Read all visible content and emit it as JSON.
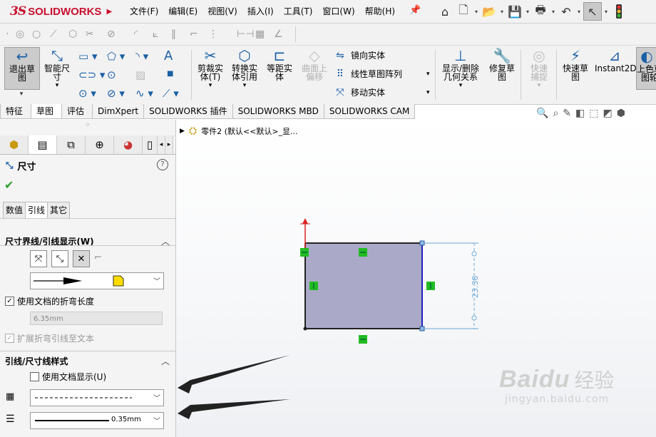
{
  "app": {
    "logo_prefix": "3S",
    "logo_text": "SOLIDWORKS"
  },
  "menu": [
    "文件(F)",
    "编辑(E)",
    "视图(V)",
    "插入(I)",
    "工具(T)",
    "窗口(W)",
    "帮助(H)"
  ],
  "quick_tools": [
    "home-icon",
    "new-document-icon",
    "open-icon",
    "save-icon",
    "print-icon",
    "undo-icon",
    "select-pointer-icon",
    "traffic-light-icon"
  ],
  "ribbon": {
    "exit_sketch": "退出草图",
    "smart_dimension": "智能尺寸",
    "trim": "剪裁实体(T)",
    "convert": "转换实体引用",
    "offset": "等距实体",
    "surface_offset": "曲面上偏移",
    "mirror": "镜向实体",
    "linear_pattern": "线性草图阵列",
    "move": "移动实体",
    "show_relations": "显示/删除几何关系",
    "repair": "修复草图",
    "quick_snap": "快速捕捉",
    "rapid_sketch": "快速草图",
    "instant2d": "Instant2D",
    "shaded": "上色草图轮"
  },
  "command_tabs": [
    "特征",
    "草图",
    "评估",
    "DimXpert",
    "SOLIDWORKS 插件",
    "SOLIDWORKS MBD",
    "SOLIDWORKS CAM"
  ],
  "active_tab": "草图",
  "panel": {
    "title": "尺寸",
    "subtabs": [
      "数值",
      "引线",
      "其它"
    ],
    "active_subtab": "引线",
    "section1": {
      "title": "尺寸界线/引线显示(W)",
      "use_doc_bend": "使用文档的折弯长度",
      "bend_length": "6.35mm",
      "extend_bend": "扩展折弯引线至文本"
    },
    "section2": {
      "title": "引线/尺寸线样式",
      "use_doc_display": "使用文档显示(U)",
      "line_thickness": "0.35mm"
    }
  },
  "graphics": {
    "tree_label": "零件2 (默认<<默认>_显...",
    "dimension": "23.38",
    "colors": {
      "fill": "#aaaac8",
      "edge": "#2020c0",
      "dim": "#6aa8d8",
      "relation": "#22bb22",
      "origin": "#dd2222"
    }
  },
  "watermark": {
    "brand": "Baidu",
    "cn": "经验",
    "url": "jingyan.baidu.com"
  }
}
